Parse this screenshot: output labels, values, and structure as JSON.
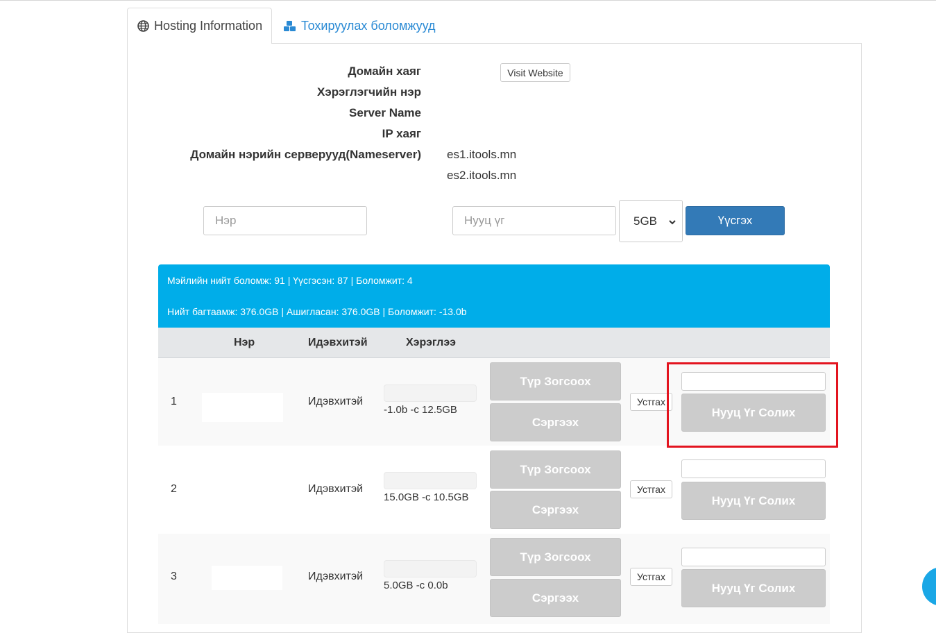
{
  "tabs": [
    {
      "label": "Hosting Information",
      "icon": "globe-icon",
      "active": true
    },
    {
      "label": "Тохируулах боломжууд",
      "icon": "cubes-icon",
      "active": false
    }
  ],
  "info": {
    "domain_label": "Домайн хаяг",
    "visit_label": "Visit Website",
    "username_label": "Хэрэглэгчийн нэр",
    "server_label": "Server Name",
    "ip_label": "IP хаяг",
    "ns_label": "Домайн нэрийн серверууд(Nameserver)",
    "nameservers": [
      "es1.itools.mn",
      "es2.itools.mn"
    ]
  },
  "form": {
    "name_placeholder": "Нэр",
    "password_placeholder": "Нууц үг",
    "quota_value": "5GB",
    "create_label": "Үүсгэх"
  },
  "banners": {
    "mail": "Мэйлийн нийт боломж: 91 | Үүсгэсэн: 87 | Боломжит: 4",
    "storage": "Нийт багтаамж: 376.0GB | Ашигласан: 376.0GB | Боломжит: -13.0b"
  },
  "table": {
    "headers": {
      "name": "Нэр",
      "status": "Идэвхитэй",
      "usage": "Хэрэглээ"
    },
    "rows": [
      {
        "index": "1",
        "status": "Идэвхитэй",
        "usage": "-1.0b -с 12.5GB",
        "suspend": "Түр Зогсоох",
        "restore": "Сэргээх",
        "delete": "Устгах",
        "change_pw": "Нууц Үг Солих"
      },
      {
        "index": "2",
        "status": "Идэвхитэй",
        "usage": "15.0GB -с 10.5GB",
        "suspend": "Түр Зогсоох",
        "restore": "Сэргээх",
        "delete": "Устгах",
        "change_pw": "Нууц Үг Солих"
      },
      {
        "index": "3",
        "status": "Идэвхитэй",
        "usage": "5.0GB -с 0.0b",
        "suspend": "Түр Зогсоох",
        "restore": "Сэргээх",
        "delete": "Устгах",
        "change_pw": "Нууц Үг Солих"
      }
    ]
  },
  "colors": {
    "accent": "#337ab7",
    "banner": "#00ade9",
    "link": "#2a8ad4",
    "highlight": "#e3141f",
    "disabled_button": "#cccccc"
  }
}
